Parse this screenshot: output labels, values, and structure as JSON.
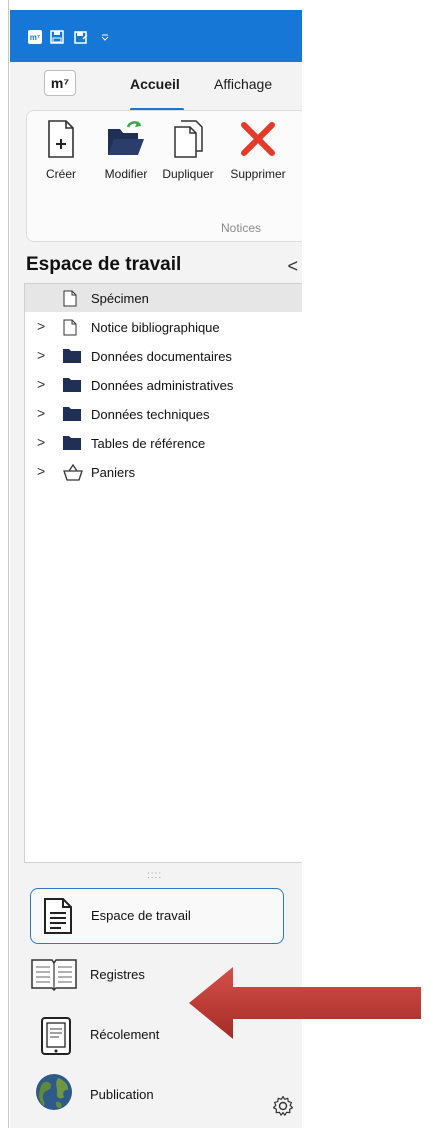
{
  "quick_access": {
    "logo": "m⁷",
    "icons": [
      "app-logo-icon",
      "save-icon",
      "save-as-icon",
      "customize-dropdown-icon"
    ]
  },
  "ribbon": {
    "app_logo": "m⁷",
    "tabs": [
      {
        "label": "Accueil",
        "active": true
      },
      {
        "label": "Affichage",
        "active": false
      }
    ],
    "buttons": [
      {
        "label": "Créer",
        "icon": "create-document-icon"
      },
      {
        "label": "Modifier",
        "icon": "edit-folder-icon"
      },
      {
        "label": "Dupliquer",
        "icon": "duplicate-icon"
      },
      {
        "label": "Supprimer",
        "icon": "delete-icon"
      }
    ],
    "group_label": "Notices"
  },
  "workspace": {
    "title": "Espace de travail",
    "collapse_glyph": "<",
    "tree": [
      {
        "label": "Spécimen",
        "icon": "document-icon",
        "expandable": false,
        "selected": true
      },
      {
        "label": "Notice bibliographique",
        "icon": "document-icon",
        "expandable": true
      },
      {
        "label": "Données documentaires",
        "icon": "folder-icon",
        "expandable": true
      },
      {
        "label": "Données administratives",
        "icon": "folder-icon",
        "expandable": true
      },
      {
        "label": "Données techniques",
        "icon": "folder-icon",
        "expandable": true
      },
      {
        "label": "Tables de référence",
        "icon": "folder-icon",
        "expandable": true
      },
      {
        "label": "Paniers",
        "icon": "basket-icon",
        "expandable": true
      }
    ],
    "splitter": "::::"
  },
  "navigation": [
    {
      "label": "Espace de travail",
      "icon": "workspace-document-icon",
      "active": true
    },
    {
      "label": "Registres",
      "icon": "book-icon",
      "active": false
    },
    {
      "label": "Récolement",
      "icon": "tablet-icon",
      "active": false
    },
    {
      "label": "Publication",
      "icon": "globe-icon",
      "active": false
    }
  ],
  "colors": {
    "accent": "#1777d6",
    "folder": "#1f2f55",
    "delete": "#e53a2a",
    "annotation_arrow": "#c0392b"
  }
}
